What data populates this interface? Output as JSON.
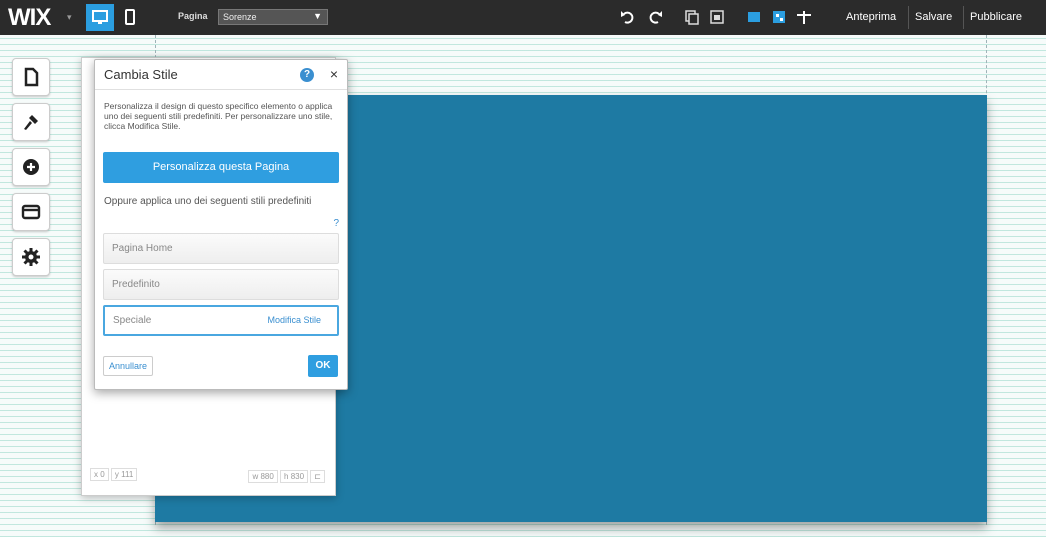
{
  "topbar": {
    "logo": "WIX",
    "logo_caret": "▾",
    "page_label": "Pagina",
    "page_value": "Sorenze",
    "preview": "Anteprima",
    "save": "Salvare",
    "publish": "Pubblicare"
  },
  "dialog": {
    "title": "Cambia Stile",
    "help": "?",
    "close": "×",
    "description": "Personalizza il design di questo specifico elemento o applica uno dei seguenti stili predefiniti. Per personalizzare uno stile, clicca Modifica Stile.",
    "customize_button": "Personalizza questa Pagina",
    "or_text": "Oppure applica uno dei seguenti stili predefiniti",
    "question": "?",
    "styles": [
      {
        "label": "Pagina Home"
      },
      {
        "label": "Predefinito"
      },
      {
        "label": "Speciale",
        "edit": "Modifica Stile"
      }
    ],
    "cancel": "Annullare",
    "ok": "OK"
  },
  "panel_footer": {
    "x": "x 0",
    "y": "y 111",
    "w": "w 880",
    "h": "h 830"
  },
  "colors": {
    "accent": "#2f9ee0",
    "topbar": "#2b2b2b",
    "strip": "#1e7aa3"
  }
}
